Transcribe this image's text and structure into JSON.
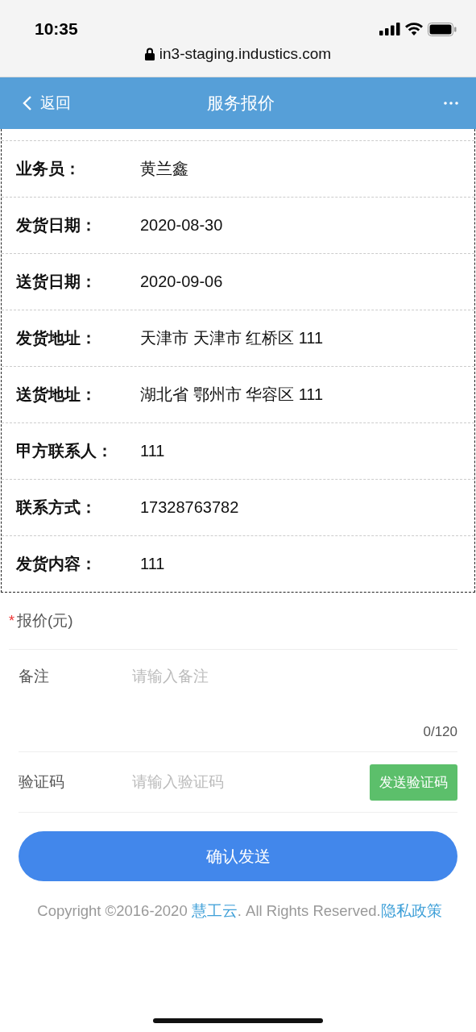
{
  "status_bar": {
    "time": "10:35"
  },
  "browser": {
    "url": "in3-staging.industics.com"
  },
  "header": {
    "back": "返回",
    "title": "服务报价"
  },
  "details": [
    {
      "label": "业务员：",
      "value": "黄兰鑫"
    },
    {
      "label": "发货日期：",
      "value": "2020-08-30"
    },
    {
      "label": "送货日期：",
      "value": "2020-09-06"
    },
    {
      "label": "发货地址：",
      "value": "天津市 天津市 红桥区 111"
    },
    {
      "label": "送货地址：",
      "value": "湖北省 鄂州市 华容区 111"
    },
    {
      "label": "甲方联系人：",
      "value": "111"
    },
    {
      "label": "联系方式：",
      "value": "17328763782"
    },
    {
      "label": "发货内容：",
      "value": "111"
    }
  ],
  "form": {
    "price": {
      "required_mark": "*",
      "label": "报价(元)"
    },
    "remark": {
      "label": "备注",
      "placeholder": "请输入备注",
      "counter": "0/120"
    },
    "code": {
      "label": "验证码",
      "placeholder": "请输入验证码",
      "button": "发送验证码"
    },
    "submit": "确认发送"
  },
  "footer": {
    "prefix": "Copyright ©2016-2020 ",
    "brand_link": "慧工云",
    "middle": ". All Rights Reserved.",
    "privacy_link": "隐私政策"
  }
}
